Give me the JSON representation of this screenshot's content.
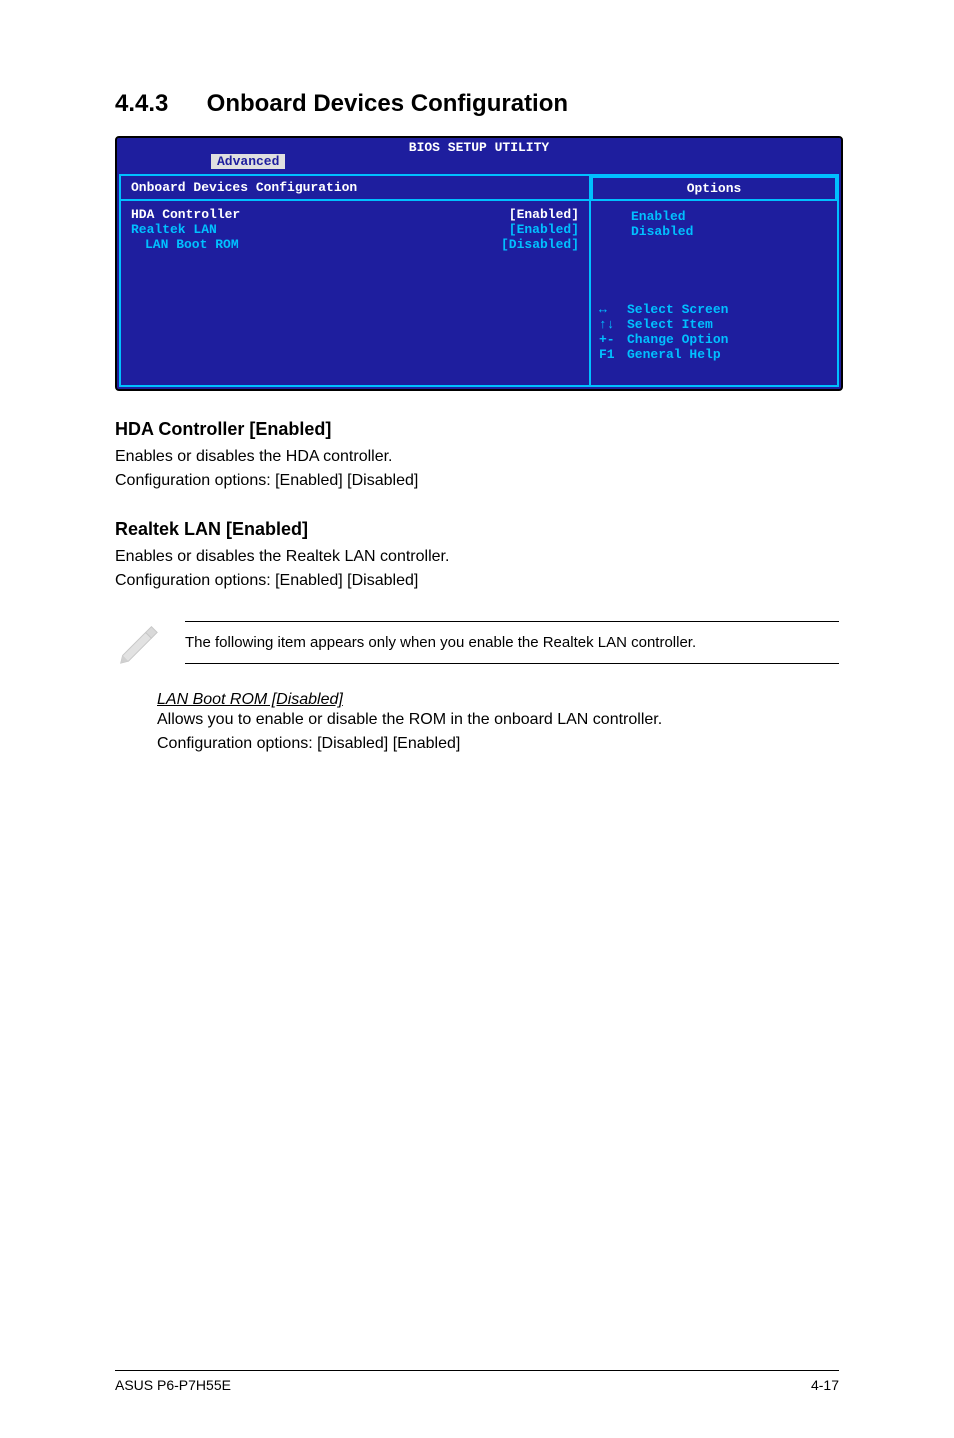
{
  "section": {
    "number": "4.4.3",
    "title": "Onboard Devices Configuration"
  },
  "bios": {
    "header_title": "BIOS SETUP UTILITY",
    "tab": "Advanced",
    "panel_title": "Onboard Devices Configuration",
    "items": [
      {
        "label": "HDA Controller",
        "value": "[Enabled]",
        "selected": true,
        "indent": 0
      },
      {
        "label": "Realtek LAN",
        "value": "[Enabled]",
        "selected": false,
        "indent": 0
      },
      {
        "label": "LAN Boot ROM",
        "value": "[Disabled]",
        "selected": false,
        "indent": 1
      }
    ],
    "options_header": "Options",
    "options": [
      "Enabled",
      "Disabled"
    ],
    "nav": [
      {
        "sym": "↔",
        "label": "Select Screen"
      },
      {
        "sym": "↑↓",
        "label": "Select Item"
      },
      {
        "sym": "+-",
        "label": "Change Option"
      },
      {
        "sym": "F1",
        "label": "General Help"
      }
    ]
  },
  "body": {
    "hda": {
      "heading": "HDA Controller [Enabled]",
      "line1": "Enables or disables the HDA controller.",
      "line2": "Configuration options: [Enabled] [Disabled]"
    },
    "realtek": {
      "heading": "Realtek LAN [Enabled]",
      "line1": "Enables or disables the Realtek LAN controller.",
      "line2": "Configuration options: [Enabled] [Disabled]"
    },
    "note": "The following item appears only when you enable the Realtek LAN controller.",
    "lanboot": {
      "heading": "LAN Boot ROM [Disabled]",
      "line1": "Allows you to enable or disable the ROM in the onboard LAN controller.",
      "line2": "Configuration options: [Disabled] [Enabled]"
    }
  },
  "footer": {
    "left": "ASUS P6-P7H55E",
    "right": "4-17"
  }
}
